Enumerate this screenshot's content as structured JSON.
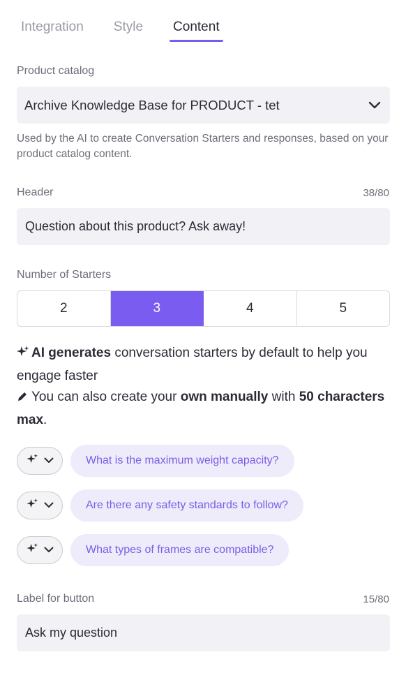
{
  "tabs": [
    "Integration",
    "Style",
    "Content"
  ],
  "active_tab": "Content",
  "catalog": {
    "label": "Product catalog",
    "value": "Archive Knowledge Base for PRODUCT - tet",
    "help": "Used by the AI to create Conversation Starters and responses, based on your product catalog content."
  },
  "header": {
    "label": "Header",
    "counter": "38/80",
    "value": "Question about this product? Ask away!"
  },
  "starters_count": {
    "label": "Number of Starters",
    "options": [
      "2",
      "3",
      "4",
      "5"
    ],
    "selected": "3"
  },
  "info": {
    "line1_bold": "AI generates",
    "line1_rest": " conversation starters by default to help you engage faster",
    "line2_a": "You can also create your ",
    "line2_bold1": "own manually",
    "line2_b": " with ",
    "line2_bold2": "50 characters max",
    "line2_c": "."
  },
  "starters": [
    "What is the maximum weight capacity?",
    "Are there any safety standards to follow?",
    "What types of frames are compatible?"
  ],
  "button_label": {
    "label": "Label for button",
    "counter": "15/80",
    "value": "Ask my question"
  },
  "colors": {
    "accent": "#7b5cf0",
    "pill_bg": "#eeebfb",
    "pill_text": "#7a5ee6",
    "field_bg": "#f2f2f6"
  }
}
